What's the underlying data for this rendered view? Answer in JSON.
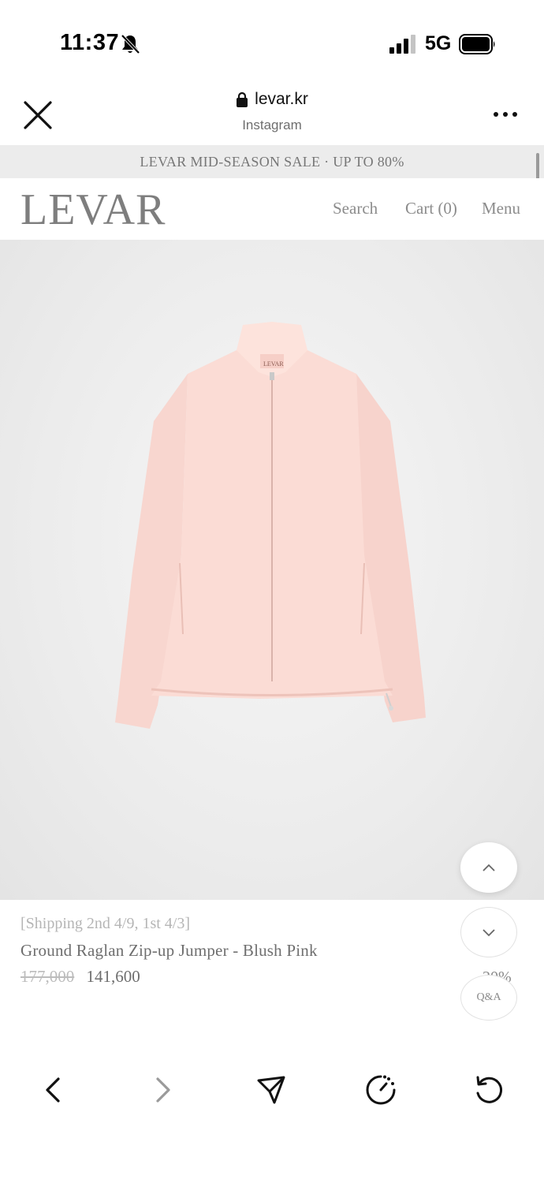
{
  "status_bar": {
    "time": "11:37",
    "network": "5G",
    "icons": [
      "bell-slash-icon",
      "signal-icon",
      "battery-icon"
    ]
  },
  "browser": {
    "url": "levar.kr",
    "source": "Instagram",
    "icons": [
      "close-icon",
      "lock-icon",
      "more-icon"
    ]
  },
  "promo_banner": "LEVAR MID-SEASON SALE · UP TO 80%",
  "site_header": {
    "logo": "LEVAR",
    "nav": {
      "search": "Search",
      "cart": "Cart (0)",
      "menu": "Menu"
    }
  },
  "product": {
    "image_alt": "pink zip-up jacket",
    "shipping": "[Shipping 2nd 4/9, 1st 4/3]",
    "name": "Ground Raglan Zip-up Jumper - Blush Pink",
    "original_price": "177,000",
    "sale_price": "141,600",
    "discount": "20%"
  },
  "floating_buttons": {
    "qa_label": "Q&A",
    "icons": [
      "chevron-up-icon",
      "chevron-down-icon"
    ]
  },
  "toolbar": {
    "icons": [
      "back-icon",
      "forward-icon",
      "share-icon",
      "speed-icon",
      "reload-icon"
    ]
  },
  "colors": {
    "promo_bg": "#ececec",
    "jacket": "#f9d7d0",
    "text_muted": "#8c8c8c"
  }
}
